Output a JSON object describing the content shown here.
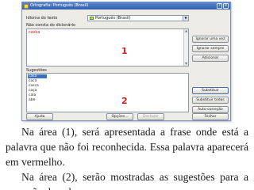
{
  "dialog": {
    "title": "Ortografia: Português (Brasil)",
    "help_glyph": "?",
    "close_glyph": "x",
    "language_label": "Idioma do texto",
    "language_value": "Português (Brasil)",
    "not_found_label": "Não consta do dicionário",
    "not_found_word": "caska",
    "suggestions_label": "Sugestões",
    "suggestions": [
      "casa",
      "caca",
      "casca",
      "caça",
      "cala",
      "abe"
    ],
    "marker_1": "1",
    "marker_2": "2",
    "buttons": {
      "ignore_once": "Ignorar uma vez",
      "ignore_always": "Ignorar sempre",
      "add": "Adicionar",
      "change": "Substituir",
      "change_all": "Substituir todas",
      "autocorrect": "Auto-correção",
      "help": "Ajuda",
      "options": "Opções...",
      "undo": "Desfazer",
      "close": "Fechar"
    }
  },
  "caption": {
    "paragraph_1": "Na área (1), será apresentada a frase onde está a palavra que não foi  reconhecida. Essa palavra aparecerá em vermelho.",
    "paragraph_2": "Na área (2), serão mostradas as sugestões para a correção da palavra."
  }
}
